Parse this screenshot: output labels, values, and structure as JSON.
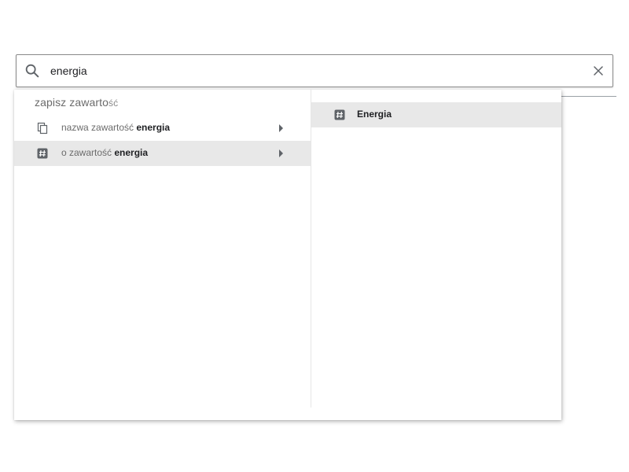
{
  "search": {
    "value": "energia",
    "icon": "search-icon",
    "clear_icon": "close-icon"
  },
  "dropdown": {
    "section_header": "zapisz zawarto",
    "section_header_tail": "ść",
    "items": [
      {
        "icon": "copy-icon",
        "prefix": "nazwa zawartość ",
        "keyword": "energia",
        "selected": false
      },
      {
        "icon": "hashtag-icon",
        "prefix": "o zawartość ",
        "keyword": "energia",
        "selected": true
      }
    ],
    "results": [
      {
        "icon": "hashtag-icon",
        "label": "Energia",
        "selected": true
      }
    ]
  },
  "colors": {
    "selected_row": "#e8e8e8",
    "icon_gray": "#5f6368",
    "muted_text": "#6b6b6b"
  }
}
